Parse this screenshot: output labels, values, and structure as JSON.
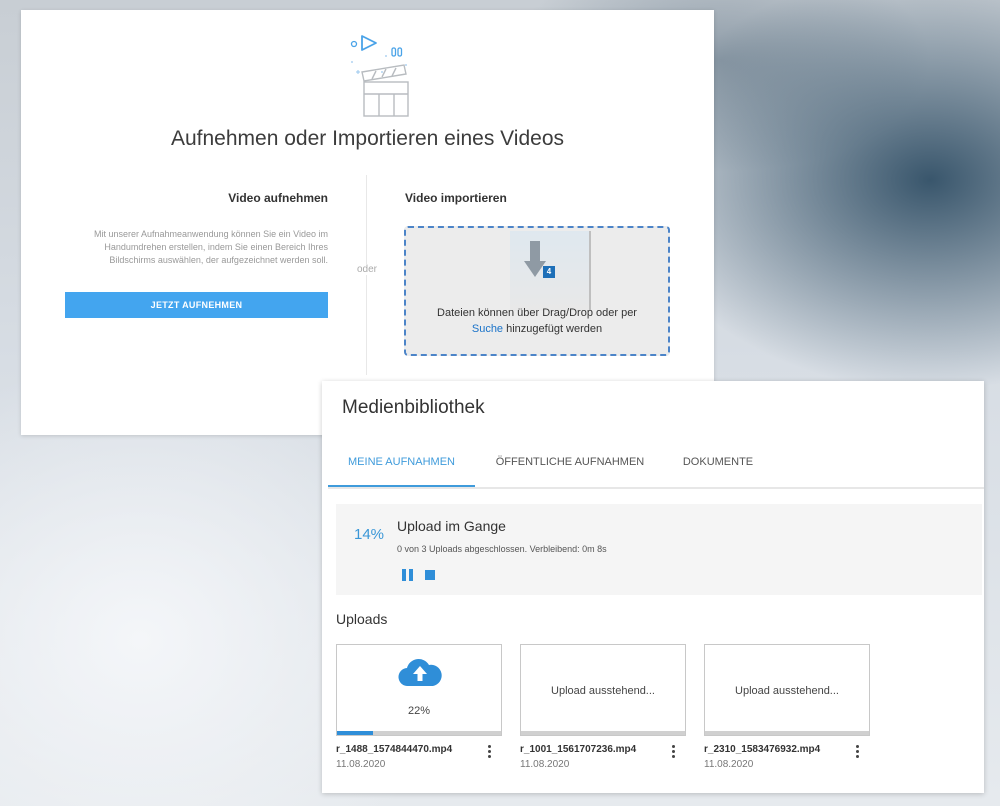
{
  "record_import": {
    "title": "Aufnehmen oder Importieren eines Videos",
    "record": {
      "heading": "Video aufnehmen",
      "description": "Mit unserer Aufnahmeanwendung können Sie ein Video im Handumdrehen erstellen, indem Sie einen Bereich Ihres Bildschirms auswählen, der aufgezeichnet werden soll.",
      "button_label": "JETZT AUFNEHMEN"
    },
    "or_label": "oder",
    "import": {
      "heading": "Video importieren",
      "drag_badge": "4",
      "drop_text_before": "Dateien können über Drag/Drop oder per",
      "drop_link": "Suche",
      "drop_text_after": "hinzugefügt werden"
    }
  },
  "media_library": {
    "title": "Medienbibliothek",
    "tabs": [
      {
        "label": "MEINE AUFNAHMEN",
        "active": true
      },
      {
        "label": "ÖFFENTLICHE AUFNAHMEN",
        "active": false
      },
      {
        "label": "DOKUMENTE",
        "active": false
      }
    ],
    "progress": {
      "percent_label": "14%",
      "title": "Upload im Gange",
      "subtitle": "0 von 3 Uploads abgeschlossen. Verbleibend: 0m 8s"
    },
    "uploads_label": "Uploads",
    "uploads": [
      {
        "filename": "r_1488_1574844470.mp4",
        "date": "11.08.2020",
        "status_text": "22%",
        "progress": 0.22,
        "icon": "cloud-upload-icon"
      },
      {
        "filename": "r_1001_1561707236.mp4",
        "date": "11.08.2020",
        "status_text": "Upload ausstehend...",
        "progress": 0
      },
      {
        "filename": "r_2310_1583476932.mp4",
        "date": "11.08.2020",
        "status_text": "Upload ausstehend...",
        "progress": 0
      }
    ]
  },
  "colors": {
    "accent_blue": "#43a5ef",
    "link_blue": "#1a73c9",
    "tab_active": "#3f9bdb",
    "progress_blue": "#2f8ed8"
  }
}
